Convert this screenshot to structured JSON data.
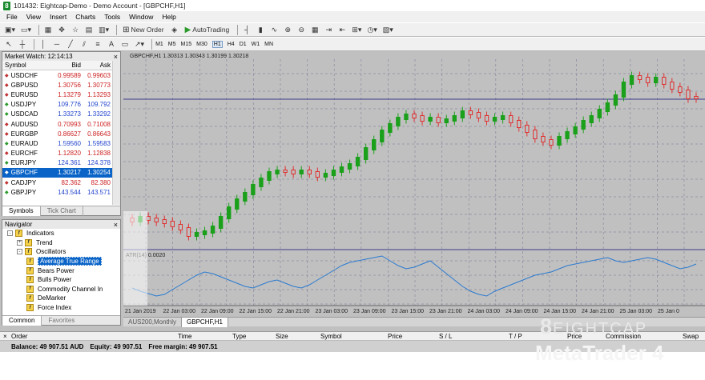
{
  "window": {
    "title": "101432: Eightcap-Demo - Demo Account - [GBPCHF,H1]",
    "app_icon": "8"
  },
  "menu": [
    "File",
    "View",
    "Insert",
    "Charts",
    "Tools",
    "Window",
    "Help"
  ],
  "toolbar": {
    "new_order": "New Order",
    "auto_trading": "AutoTrading"
  },
  "timeframes": [
    "M1",
    "M5",
    "M15",
    "M30",
    "H1",
    "H4",
    "D1",
    "W1",
    "MN"
  ],
  "active_timeframe": "H1",
  "market_watch": {
    "title": "Market Watch: 12:14:13",
    "headers": {
      "symbol": "Symbol",
      "bid": "Bid",
      "ask": "Ask"
    },
    "rows": [
      {
        "symbol": "USDCHF",
        "bid": "0.99589",
        "ask": "0.99603",
        "dir": "down"
      },
      {
        "symbol": "GBPUSD",
        "bid": "1.30756",
        "ask": "1.30773",
        "dir": "down"
      },
      {
        "symbol": "EURUSD",
        "bid": "1.13279",
        "ask": "1.13293",
        "dir": "down"
      },
      {
        "symbol": "USDJPY",
        "bid": "109.776",
        "ask": "109.792",
        "dir": "up"
      },
      {
        "symbol": "USDCAD",
        "bid": "1.33273",
        "ask": "1.33292",
        "dir": "up"
      },
      {
        "symbol": "AUDUSD",
        "bid": "0.70993",
        "ask": "0.71008",
        "dir": "down"
      },
      {
        "symbol": "EURGBP",
        "bid": "0.86627",
        "ask": "0.86643",
        "dir": "down"
      },
      {
        "symbol": "EURAUD",
        "bid": "1.59560",
        "ask": "1.59583",
        "dir": "up"
      },
      {
        "symbol": "EURCHF",
        "bid": "1.12820",
        "ask": "1.12838",
        "dir": "down"
      },
      {
        "symbol": "EURJPY",
        "bid": "124.361",
        "ask": "124.378",
        "dir": "up"
      },
      {
        "symbol": "GBPCHF",
        "bid": "1.30217",
        "ask": "1.30254",
        "dir": "down",
        "selected": true
      },
      {
        "symbol": "CADJPY",
        "bid": "82.362",
        "ask": "82.380",
        "dir": "down"
      },
      {
        "symbol": "GBPJPY",
        "bid": "143.544",
        "ask": "143.571",
        "dir": "up"
      }
    ],
    "tabs": [
      "Symbols",
      "Tick Chart"
    ]
  },
  "navigator": {
    "title": "Navigator",
    "items": [
      {
        "label": "Indicators",
        "level": 0,
        "expander": "-"
      },
      {
        "label": "Trend",
        "level": 1,
        "expander": "+"
      },
      {
        "label": "Oscillators",
        "level": 1,
        "expander": "-"
      },
      {
        "label": "Average True Range",
        "level": 2,
        "selected": true
      },
      {
        "label": "Bears Power",
        "level": 2
      },
      {
        "label": "Bulls Power",
        "level": 2
      },
      {
        "label": "Commodity Channel In",
        "level": 2
      },
      {
        "label": "DeMarker",
        "level": 2
      },
      {
        "label": "Force Index",
        "level": 2
      }
    ],
    "tabs": [
      "Common",
      "Favorites"
    ]
  },
  "chart": {
    "header": "GBPCHF,H1  1.30313 1.30343 1.30199 1.30218",
    "indicator_label": "ATR(14) 0.0020",
    "colors": {
      "background": "#c0c0c0",
      "bull": "#1aa01a",
      "bear": "#e03030",
      "atr": "#2a7ad0",
      "grid": "#8a8aa0"
    },
    "time_labels": [
      "21 Jan 2019",
      "22 Jan 03:00",
      "22 Jan 09:00",
      "22 Jan 15:00",
      "22 Jan 21:00",
      "23 Jan 03:00",
      "23 Jan 09:00",
      "23 Jan 15:00",
      "23 Jan 21:00",
      "24 Jan 03:00",
      "24 Jan 09:00",
      "24 Jan 15:00",
      "24 Jan 21:00",
      "25 Jan 03:00",
      "25 Jan 0"
    ],
    "chart_tabs": [
      "AUS200,Monthly",
      "GBPCHF,H1"
    ],
    "active_chart_tab": "GBPCHF,H1"
  },
  "terminal": {
    "columns": [
      "Order",
      "Time",
      "Type",
      "Size",
      "Symbol",
      "Price",
      "S / L",
      "T / P",
      "Price",
      "Commission",
      "Swap"
    ],
    "balance": "Balance: 49 907.51 AUD",
    "equity": "Equity: 49 907.51",
    "free_margin": "Free margin: 49 907.51"
  },
  "brand": {
    "logo_main": "8",
    "logo_rest": "EIGHTCAP",
    "product": "MetaTrader 4"
  }
}
